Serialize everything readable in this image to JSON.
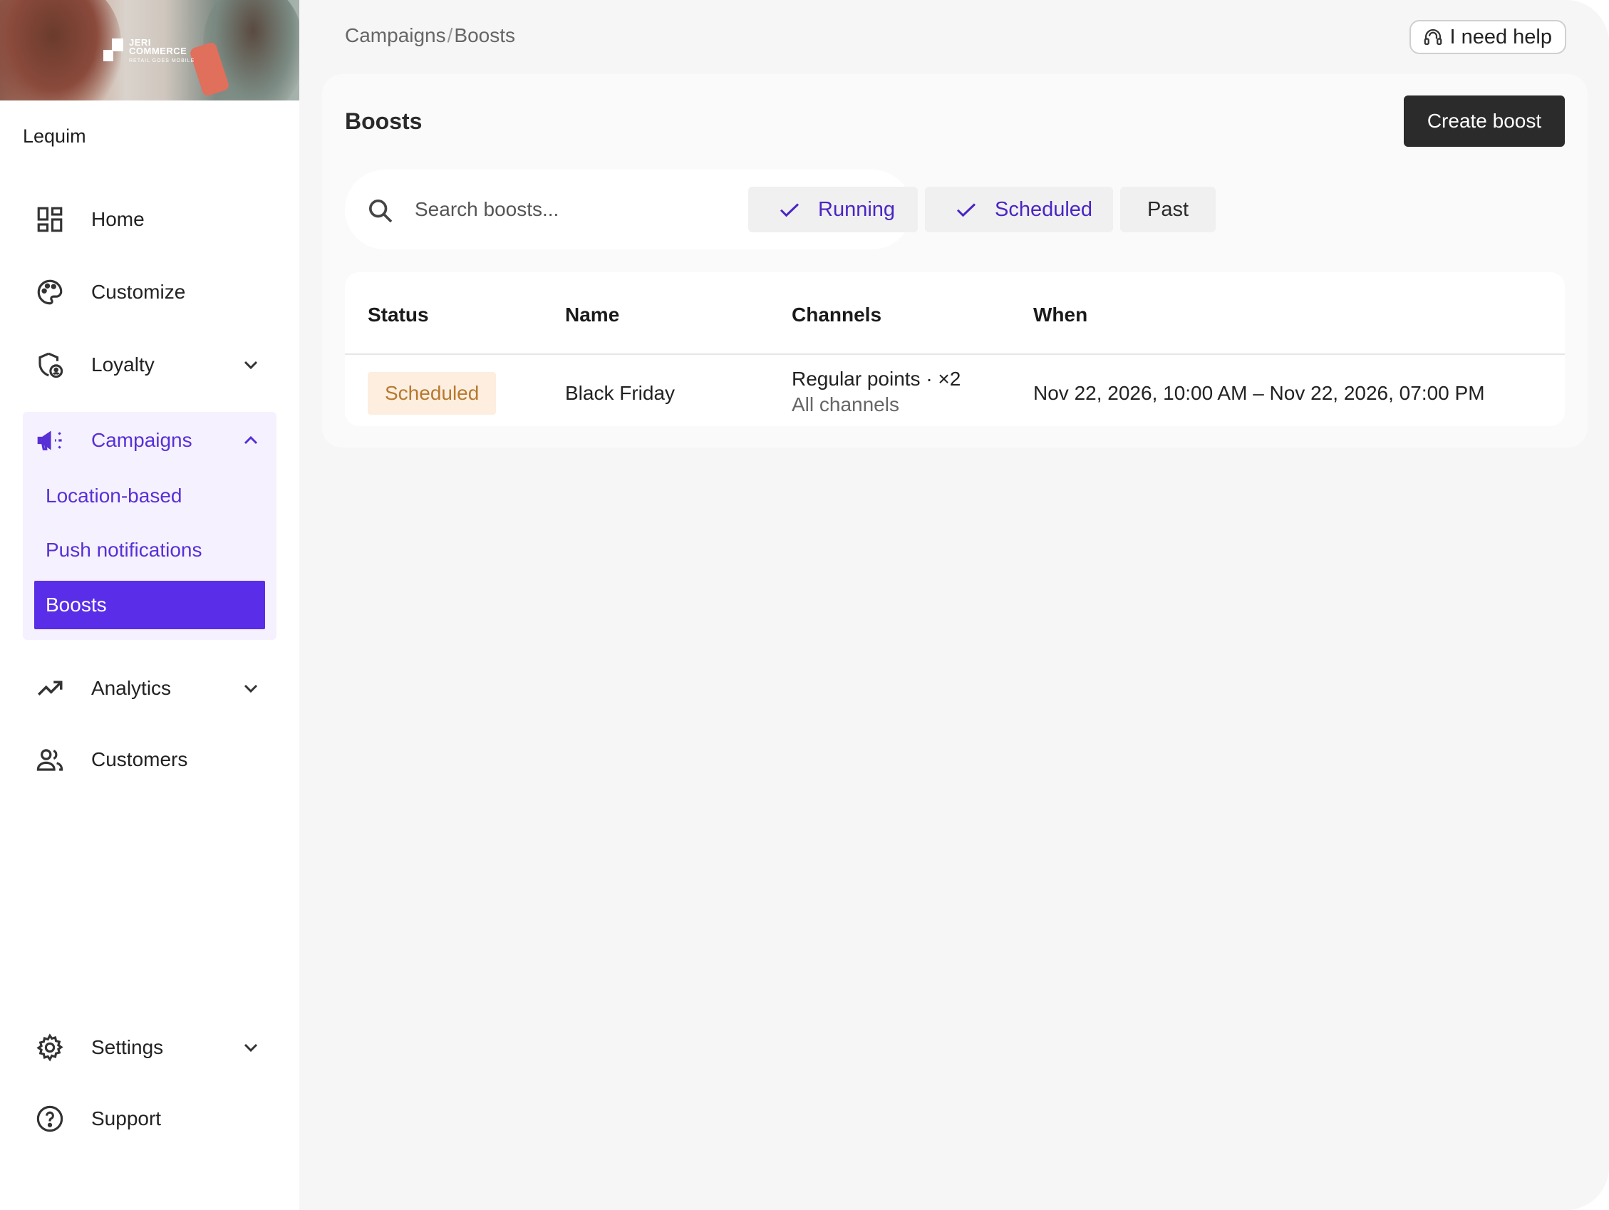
{
  "brand": {
    "logo_line1": "JERI",
    "logo_line2": "COMMERCE",
    "logo_tagline": "RETAIL GOES MOBILE"
  },
  "sidebar": {
    "org_name": "Lequim",
    "items": [
      {
        "label": "Home",
        "icon": "dashboard-icon"
      },
      {
        "label": "Customize",
        "icon": "palette-icon"
      },
      {
        "label": "Loyalty",
        "icon": "loyalty-shield-icon",
        "expandable": true
      },
      {
        "label": "Campaigns",
        "icon": "megaphone-icon",
        "expanded": true,
        "children": [
          {
            "label": "Location-based"
          },
          {
            "label": "Push notifications"
          },
          {
            "label": "Boosts",
            "active": true
          }
        ]
      },
      {
        "label": "Analytics",
        "icon": "trending-up-icon",
        "expandable": true
      },
      {
        "label": "Customers",
        "icon": "people-icon"
      },
      {
        "label": "Settings",
        "icon": "gear-icon",
        "expandable": true
      },
      {
        "label": "Support",
        "icon": "help-circle-icon"
      }
    ],
    "accent_color": "#5a2ee8"
  },
  "header": {
    "breadcrumb": [
      "Campaigns",
      "Boosts"
    ],
    "breadcrumb_sep": "/",
    "help_label": "I need help"
  },
  "main": {
    "title": "Boosts",
    "create_label": "Create boost",
    "search": {
      "placeholder": "Search boosts...",
      "value": ""
    },
    "filters": [
      {
        "label": "Running",
        "selected": true
      },
      {
        "label": "Scheduled",
        "selected": true
      },
      {
        "label": "Past",
        "selected": false
      }
    ],
    "table": {
      "columns": [
        "Status",
        "Name",
        "Channels",
        "When"
      ],
      "rows": [
        {
          "status": "Scheduled",
          "name": "Black Friday",
          "channel_primary": "Regular points · ×2",
          "channel_secondary": "All channels",
          "when": "Nov 22, 2026, 10:00 AM – Nov 22, 2026, 07:00 PM"
        }
      ]
    }
  },
  "colors": {
    "status_scheduled_bg": "#fdeee0",
    "status_scheduled_text": "#b7792e",
    "filter_selected_text": "#4a25c4"
  }
}
